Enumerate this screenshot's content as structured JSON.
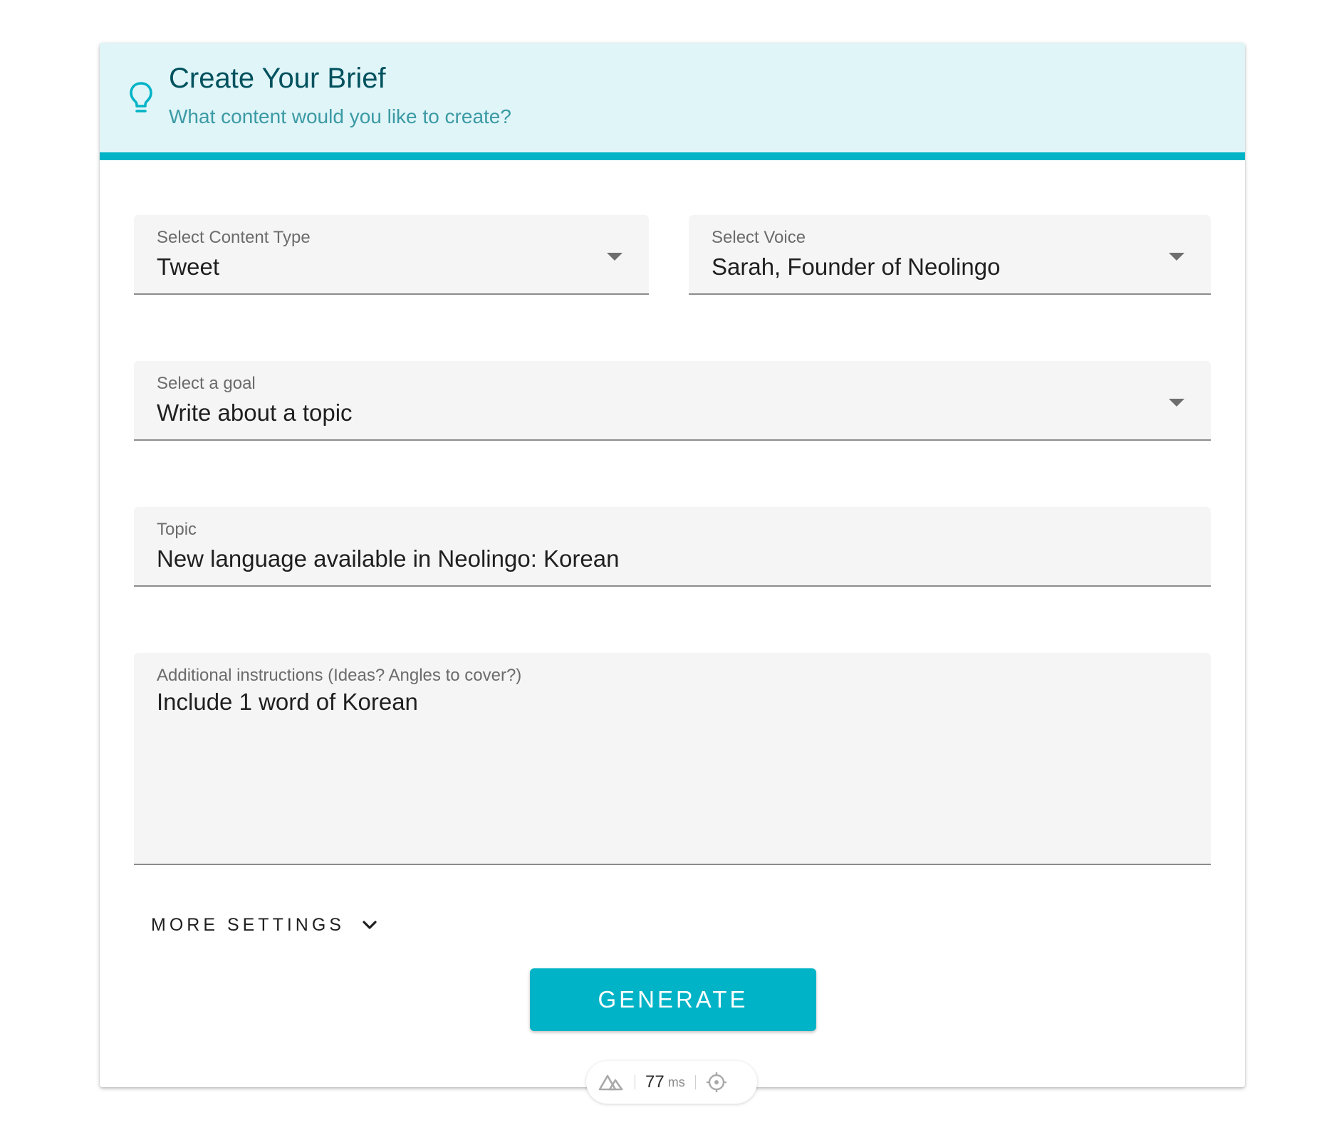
{
  "header": {
    "title": "Create Your Brief",
    "subtitle": "What content would you like to create?",
    "icon": "lightbulb-icon",
    "accent_color": "#00b3c6",
    "background_color": "#e0f5f8"
  },
  "form": {
    "content_type": {
      "label": "Select Content Type",
      "value": "Tweet"
    },
    "voice": {
      "label": "Select Voice",
      "value": "Sarah, Founder of Neolingo"
    },
    "goal": {
      "label": "Select a goal",
      "value": "Write about a topic"
    },
    "topic": {
      "label": "Topic",
      "value": "New language available in Neolingo: Korean"
    },
    "instructions": {
      "label": "Additional instructions (Ideas? Angles to cover?)",
      "value": "Include 1 word of Korean"
    }
  },
  "more_settings": {
    "label": "MORE SETTINGS",
    "icon": "chevron-down-icon"
  },
  "generate": {
    "label": "GENERATE",
    "color": "#00b3c6"
  },
  "perf_indicator": {
    "value": "77",
    "unit": "ms",
    "icons": [
      "nuxt-logo-icon",
      "crosshair-icon"
    ]
  }
}
